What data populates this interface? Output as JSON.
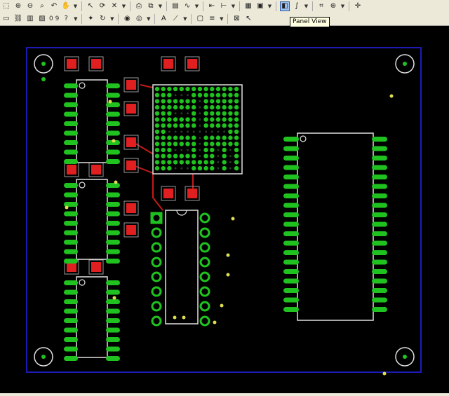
{
  "toolbar": {
    "row1": [
      {
        "name": "select-tool-icon",
        "glyph": "⬚"
      },
      {
        "name": "zoom-in-icon",
        "glyph": "⊕"
      },
      {
        "name": "zoom-out-icon",
        "glyph": "⊖"
      },
      {
        "name": "zoom-window-icon",
        "glyph": "⌕"
      },
      {
        "name": "zoom-previous-icon",
        "glyph": "↶"
      },
      {
        "name": "pan-hand-icon",
        "glyph": "✋"
      },
      {
        "name": "pointer-icon",
        "glyph": "↖"
      },
      {
        "name": "redraw-icon",
        "glyph": "⟳"
      },
      {
        "name": "delete-icon",
        "glyph": "✕"
      },
      {
        "name": "print-icon",
        "glyph": "⎙"
      },
      {
        "name": "copy-icon",
        "glyph": "⧉"
      },
      {
        "name": "paste-icon",
        "glyph": "▤"
      },
      {
        "name": "trace-icon",
        "glyph": "∿"
      },
      {
        "name": "measure-icon",
        "glyph": "⇤"
      },
      {
        "name": "dimension-icon",
        "glyph": "⊢"
      },
      {
        "name": "layer-icon",
        "glyph": "▦"
      },
      {
        "name": "color-layers-icon",
        "glyph": "▣"
      },
      {
        "name": "panel-view-icon",
        "glyph": "◧"
      },
      {
        "name": "net-icon",
        "glyph": "∫"
      },
      {
        "name": "grid-icon",
        "glyph": "⌗"
      },
      {
        "name": "snap-icon",
        "glyph": "⊕"
      },
      {
        "name": "origin-icon",
        "glyph": "✛"
      }
    ],
    "row2": [
      {
        "name": "select-all-icon",
        "glyph": "▭"
      },
      {
        "name": "link-icon",
        "glyph": "⛓"
      },
      {
        "name": "component-icon",
        "glyph": "▥"
      },
      {
        "name": "properties-icon",
        "glyph": "▨"
      },
      {
        "name": "query-icon",
        "glyph": "?"
      },
      {
        "name": "light-icon",
        "glyph": "✦"
      },
      {
        "name": "rotate-icon",
        "glyph": "↻"
      },
      {
        "name": "pad-icon",
        "glyph": "◉"
      },
      {
        "name": "via-icon",
        "glyph": "◎"
      },
      {
        "name": "text-icon",
        "glyph": "A"
      },
      {
        "name": "route-icon",
        "glyph": "⟋"
      },
      {
        "name": "place-icon",
        "glyph": "▢"
      },
      {
        "name": "bus-icon",
        "glyph": "≡"
      },
      {
        "name": "drc-icon",
        "glyph": "⊠"
      },
      {
        "name": "cursor-icon",
        "glyph": "↖"
      }
    ],
    "zoom_label": "0 9",
    "tooltip": "Panel View"
  },
  "colors": {
    "board_outline": "#1c1cb4",
    "pad": "#1fc21f",
    "smd_pad": "#e02020",
    "trace": "#c41a1a",
    "silkscreen": "#e0e0e0",
    "via": "#dede50",
    "toolbar_bg": "#ece9d8"
  }
}
